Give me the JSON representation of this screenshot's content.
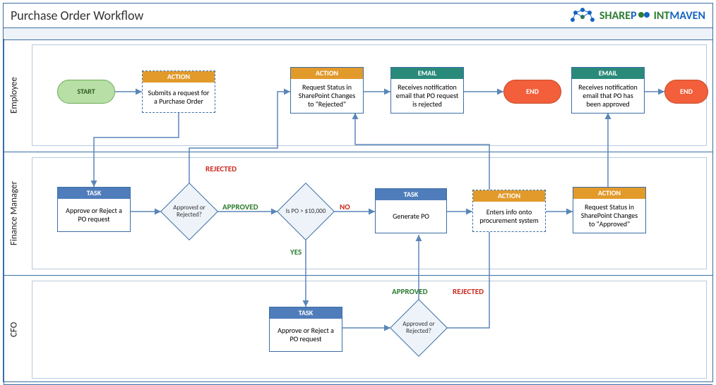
{
  "title": "Purchase Order Workflow",
  "logo": {
    "brand1": "SHARE",
    "brand2": "P",
    "brand3": "INT",
    "brand4": "MAVEN"
  },
  "lanes": {
    "employee": "Employee",
    "finance": "Finance Manager",
    "cfo": "CFO"
  },
  "nodes": {
    "start": "START",
    "end1": "END",
    "end2": "END",
    "action_submit": {
      "hdr": "ACTION",
      "body": "Submits a request for a Purchase Order"
    },
    "action_rejected": {
      "hdr": "ACTION",
      "body": "Request Status in SharePoint Changes to \"Rejected\""
    },
    "email_rejected": {
      "hdr": "EMAIL",
      "body": "Receives notification email that PO request is rejected"
    },
    "email_approved": {
      "hdr": "EMAIL",
      "body": "Receives notification email that PO has been approved"
    },
    "task_approve1": {
      "hdr": "TASK",
      "body": "Approve or Reject a PO request"
    },
    "decision1": "Approved or Rejected?",
    "decision2": "Is PO > $10,000",
    "task_generate": {
      "hdr": "TASK",
      "body": "Generate PO"
    },
    "action_enter": {
      "hdr": "ACTION",
      "body": "Enters info onto procurement system"
    },
    "action_approved": {
      "hdr": "ACTION",
      "body": "Request Status in SharePoint Changes to \"Approved\""
    },
    "task_approve2": {
      "hdr": "TASK",
      "body": "Approve or Reject a PO request"
    },
    "decision3": "Approved or Rejected?"
  },
  "edges": {
    "rejected": "REJECTED",
    "approved": "APPROVED",
    "yes": "YES",
    "no": "NO"
  }
}
